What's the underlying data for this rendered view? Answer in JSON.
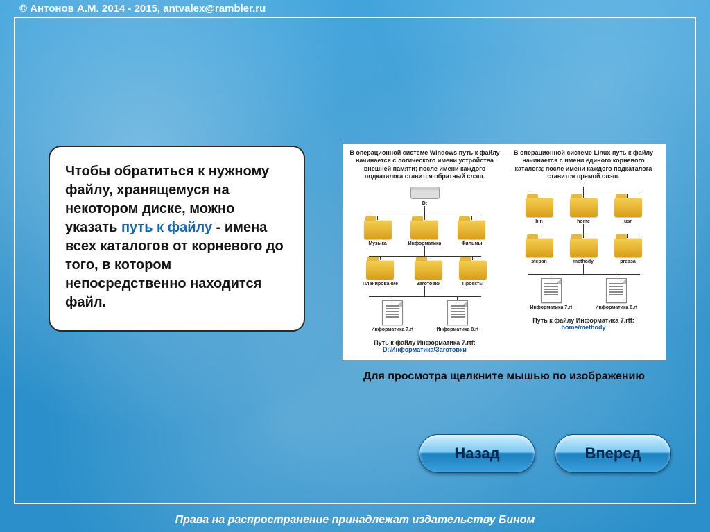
{
  "copyright": "© Антонов А.М. 2014 - 2015, antvalex@rambler.ru",
  "main": {
    "pre": "Чтобы обратиться к нужному файлу, хранящемуся на некотором диске, можно указать ",
    "highlight": "путь к файлу",
    "post": " - имена всех каталогов от корневого до того, в котором непосредственно находится файл."
  },
  "diagram": {
    "hint": "Для просмотра щелкните мышью по изображению",
    "windows": {
      "heading": "В операционной системе Windows путь к файлу начинается с логического имени устройства внешней памяти; после имени каждого подкаталога ставится обратный слэш.",
      "root": "D:",
      "row1": [
        "Музыка",
        "Информатика",
        "Фильмы"
      ],
      "row2": [
        "Планирование",
        "Заготовки",
        "Проекты"
      ],
      "files": [
        "Информатика 7.rtf",
        "Информатика 8.rtf"
      ],
      "path_label": "Путь к файлу Информатика 7.rtf:",
      "path_value": "D:\\Информатика\\Заготовки"
    },
    "linux": {
      "heading": "В операционной системе Linux путь к файлу начинается с имени единого корневого каталога; после имени каждого подкаталога ставится прямой слэш.",
      "row1": [
        "bin",
        "home",
        "usr"
      ],
      "row2": [
        "stepan",
        "methody",
        "pressa"
      ],
      "files": [
        "Информатика 7.rtf",
        "Информатика 8.rtf"
      ],
      "path_label": "Путь к файлу Информатика 7.rtf:",
      "path_value": "home/methody"
    }
  },
  "nav": {
    "back": "Назад",
    "forward": "Вперед"
  },
  "footer": "Права на распространение принадлежат издательству Бином"
}
